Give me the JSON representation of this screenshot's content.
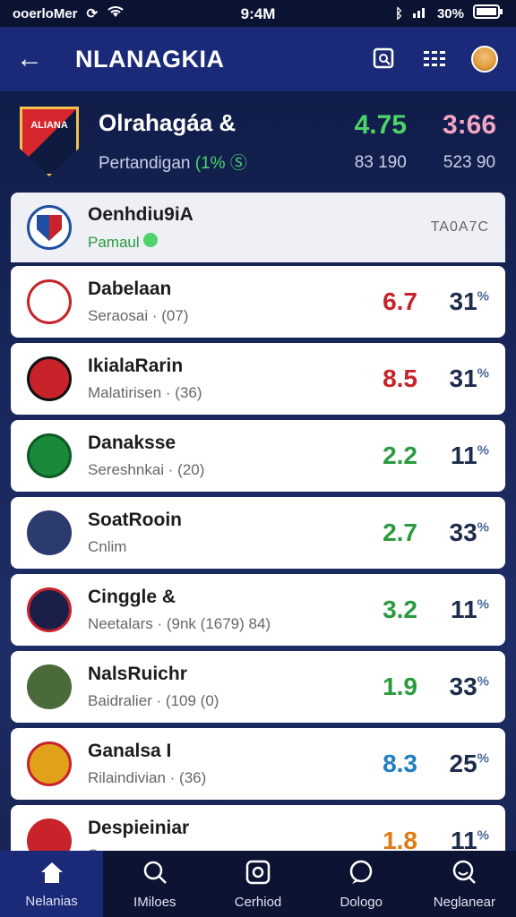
{
  "status_bar": {
    "carrier": "ooerloMer",
    "time": "9:4M",
    "battery": "30%"
  },
  "header": {
    "title": "NLANAGKIA"
  },
  "summary": {
    "logo_text": "ALIANA",
    "name": "Olrahagáa &",
    "subtitle_text": "Pertandigan",
    "subtitle_pct": "(1%",
    "value1": "4.75",
    "value1_sub": "83 190",
    "value2": "3:66",
    "value2_sub": "523 90"
  },
  "list_header": {
    "name": "Oenhdiu9iA",
    "sub": "Pamaul",
    "tag": "TA0A7C"
  },
  "rows": [
    {
      "name": "Dabelaan",
      "sub": "Seraosai · (07)",
      "rate": "6.7",
      "pct": "31",
      "logo_color": "#ffffff",
      "logo_border": "#c8232b",
      "rate_color": "red"
    },
    {
      "name": "IkialaRarin",
      "sub": "Malatirisen · (36)",
      "rate": "8.5",
      "pct": "31",
      "logo_color": "#c8232b",
      "logo_border": "#111111",
      "rate_color": "red"
    },
    {
      "name": "Danaksse",
      "sub": "Sereshnkai · (20)",
      "rate": "2.2",
      "pct": "11",
      "logo_color": "#1a8a3a",
      "logo_border": "#0d5a24",
      "rate_color": "grn"
    },
    {
      "name": "SoatRooin",
      "sub": "Cnlim",
      "rate": "2.7",
      "pct": "33",
      "logo_color": "#2b3b6e",
      "logo_border": "#2b3b6e",
      "rate_color": "grn"
    },
    {
      "name": "Cinggle &",
      "sub": "Neetalars · (9nk (1679) 84)",
      "rate": "3.2",
      "pct": "11",
      "logo_color": "#1a1f4a",
      "logo_border": "#c8232b",
      "rate_color": "grn"
    },
    {
      "name": "NalsRuichr",
      "sub": "Baidralier · (109 (0)",
      "rate": "1.9",
      "pct": "33",
      "logo_color": "#4a6a3a",
      "logo_border": "#4a6a3a",
      "rate_color": "grn"
    },
    {
      "name": "Ganalsa I",
      "sub": "Rilaindivian · (36)",
      "rate": "8.3",
      "pct": "25",
      "logo_color": "#e2a11a",
      "logo_border": "#c8232b",
      "rate_color": "blu"
    },
    {
      "name": "Despieiniar",
      "sub": "Snonn",
      "rate": "1.8",
      "pct": "11",
      "logo_color": "#c8232b",
      "logo_border": "#c8232b",
      "rate_color": "org"
    }
  ],
  "pct_super": "%",
  "nav": [
    {
      "label": "Nelanias",
      "icon": "home-icon"
    },
    {
      "label": "IMiloes",
      "icon": "search-icon"
    },
    {
      "label": "Cerhiod",
      "icon": "camera-icon"
    },
    {
      "label": "Dologo",
      "icon": "chat-icon"
    },
    {
      "label": "Neglanear",
      "icon": "profile-search-icon"
    }
  ]
}
